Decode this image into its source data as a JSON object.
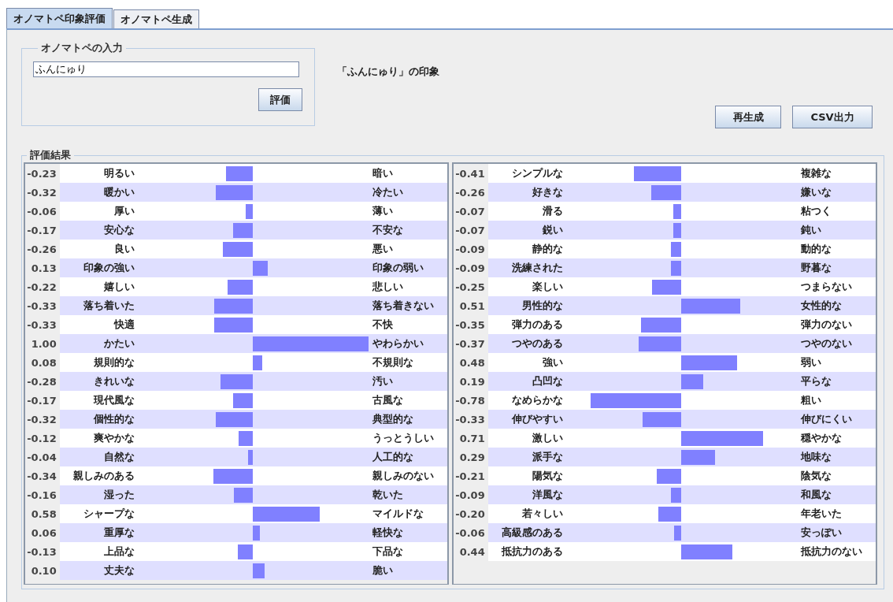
{
  "tabs": [
    {
      "label": "オノマトペ印象評価",
      "selected": true
    },
    {
      "label": "オノマトペ生成",
      "selected": false
    }
  ],
  "input_group": {
    "title": "オノマトペの入力",
    "value": "ふんにゅり",
    "button": "評価"
  },
  "impression_title": "「ふんにゅり」の印象",
  "buttons": [
    "再生成",
    "CSV出力"
  ],
  "results": {
    "title": "評価結果",
    "tables": [
      {
        "rows": [
          {
            "score": "-0.23",
            "left": "明るい",
            "right": "暗い"
          },
          {
            "score": "-0.32",
            "left": "暖かい",
            "right": "冷たい"
          },
          {
            "score": "-0.06",
            "left": "厚い",
            "right": "薄い"
          },
          {
            "score": "-0.17",
            "left": "安心な",
            "right": "不安な"
          },
          {
            "score": "-0.26",
            "left": "良い",
            "right": "悪い"
          },
          {
            "score": "0.13",
            "left": "印象の強い",
            "right": "印象の弱い"
          },
          {
            "score": "-0.22",
            "left": "嬉しい",
            "right": "悲しい"
          },
          {
            "score": "-0.33",
            "left": "落ち着いた",
            "right": "落ち着きない"
          },
          {
            "score": "-0.33",
            "left": "快適",
            "right": "不快"
          },
          {
            "score": "1.00",
            "left": "かたい",
            "right": "やわらかい"
          },
          {
            "score": "0.08",
            "left": "規則的な",
            "right": "不規則な"
          },
          {
            "score": "-0.28",
            "left": "きれいな",
            "right": "汚い"
          },
          {
            "score": "-0.17",
            "left": "現代風な",
            "right": "古風な"
          },
          {
            "score": "-0.32",
            "left": "個性的な",
            "right": "典型的な"
          },
          {
            "score": "-0.12",
            "left": "爽やかな",
            "right": "うっとうしい"
          },
          {
            "score": "-0.04",
            "left": "自然な",
            "right": "人工的な"
          },
          {
            "score": "-0.34",
            "left": "親しみのある",
            "right": "親しみのない"
          },
          {
            "score": "-0.16",
            "left": "湿った",
            "right": "乾いた"
          },
          {
            "score": "0.58",
            "left": "シャープな",
            "right": "マイルドな"
          },
          {
            "score": "0.06",
            "left": "重厚な",
            "right": "軽快な"
          },
          {
            "score": "-0.13",
            "left": "上品な",
            "right": "下品な"
          },
          {
            "score": "0.10",
            "left": "丈夫な",
            "right": "脆い"
          }
        ]
      },
      {
        "rows": [
          {
            "score": "-0.41",
            "left": "シンプルな",
            "right": "複雑な"
          },
          {
            "score": "-0.26",
            "left": "好きな",
            "right": "嫌いな"
          },
          {
            "score": "-0.07",
            "left": "滑る",
            "right": "粘つく"
          },
          {
            "score": "-0.07",
            "left": "鋭い",
            "right": "鈍い"
          },
          {
            "score": "-0.09",
            "left": "静的な",
            "right": "動的な"
          },
          {
            "score": "-0.09",
            "left": "洗練された",
            "right": "野暮な"
          },
          {
            "score": "-0.25",
            "left": "楽しい",
            "right": "つまらない"
          },
          {
            "score": "0.51",
            "left": "男性的な",
            "right": "女性的な"
          },
          {
            "score": "-0.35",
            "left": "弾力のある",
            "right": "弾力のない"
          },
          {
            "score": "-0.37",
            "left": "つやのある",
            "right": "つやのない"
          },
          {
            "score": "0.48",
            "left": "強い",
            "right": "弱い"
          },
          {
            "score": "0.19",
            "left": "凸凹な",
            "right": "平らな"
          },
          {
            "score": "-0.78",
            "left": "なめらかな",
            "right": "粗い"
          },
          {
            "score": "-0.33",
            "left": "伸びやすい",
            "right": "伸びにくい"
          },
          {
            "score": "0.71",
            "left": "激しい",
            "right": "穏やかな"
          },
          {
            "score": "0.29",
            "left": "派手な",
            "right": "地味な"
          },
          {
            "score": "-0.21",
            "left": "陽気な",
            "right": "陰気な"
          },
          {
            "score": "-0.09",
            "left": "洋風な",
            "right": "和風な"
          },
          {
            "score": "-0.20",
            "left": "若々しい",
            "right": "年老いた"
          },
          {
            "score": "-0.06",
            "left": "高級感のある",
            "right": "安っぽい"
          },
          {
            "score": "0.44",
            "left": "抵抗力のある",
            "right": "抵抗力のない"
          }
        ]
      }
    ]
  }
}
